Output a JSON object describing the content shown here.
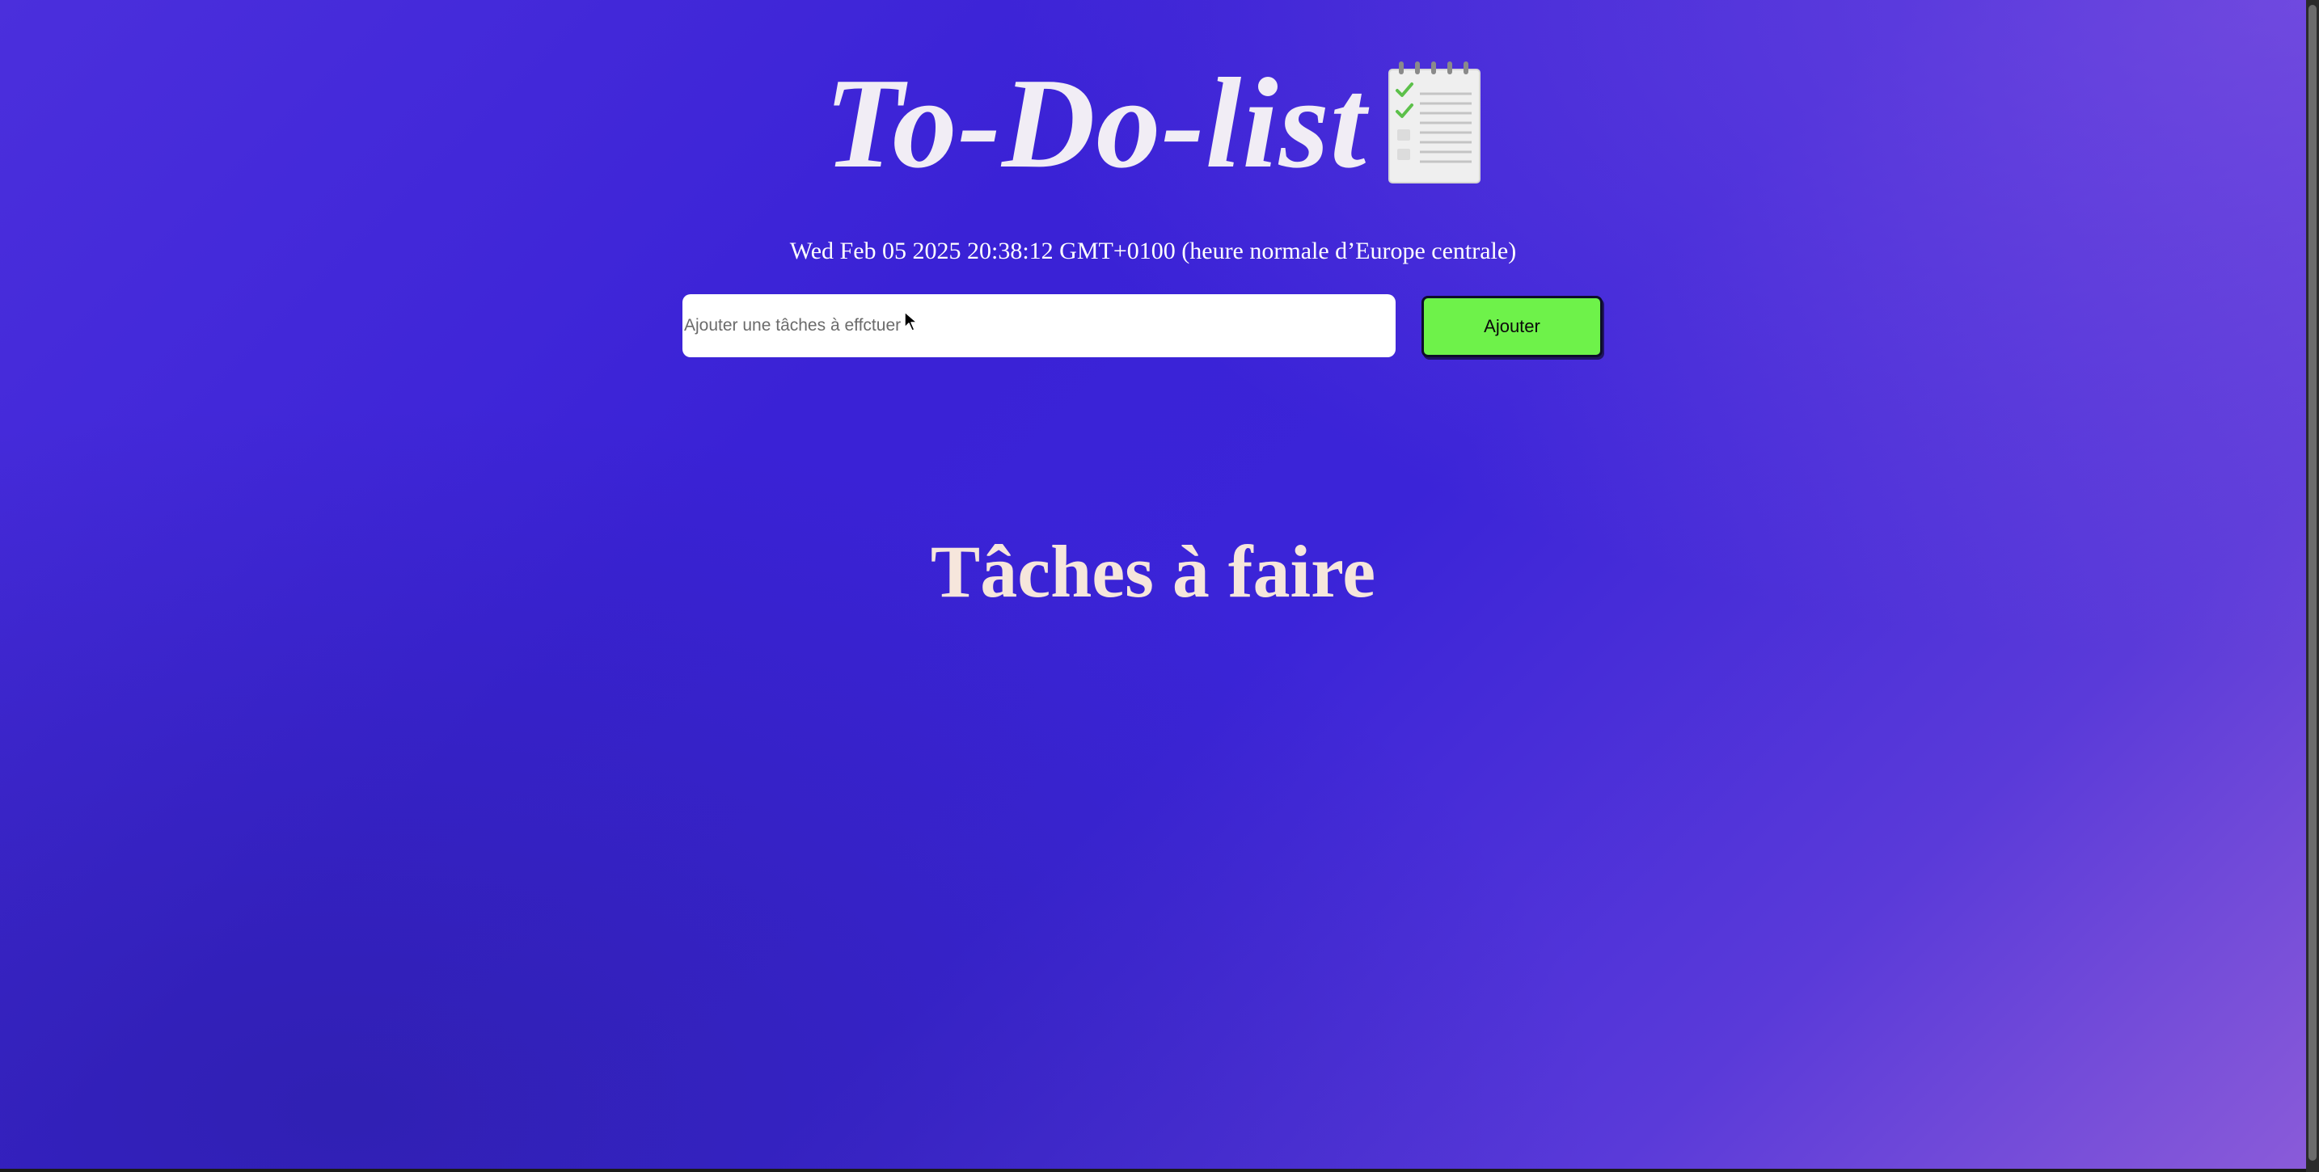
{
  "header": {
    "title": "To-Do-list",
    "icon": "notepad-checklist-icon"
  },
  "date_text": "Wed Feb 05 2025 20:38:12 GMT+0100 (heure normale d’Europe centrale)",
  "form": {
    "input_placeholder": "Ajouter une tâches à effctuer",
    "input_value": "",
    "add_button_label": "Ajouter",
    "add_button_color": "#6ef24a"
  },
  "tasks_section": {
    "title": "Tâches à faire",
    "tasks": []
  },
  "colors": {
    "background_start": "#4b2fdc",
    "background_end": "#8a5bd9",
    "title_color": "#f1edf5",
    "section_title_color": "#f6e6dc"
  }
}
